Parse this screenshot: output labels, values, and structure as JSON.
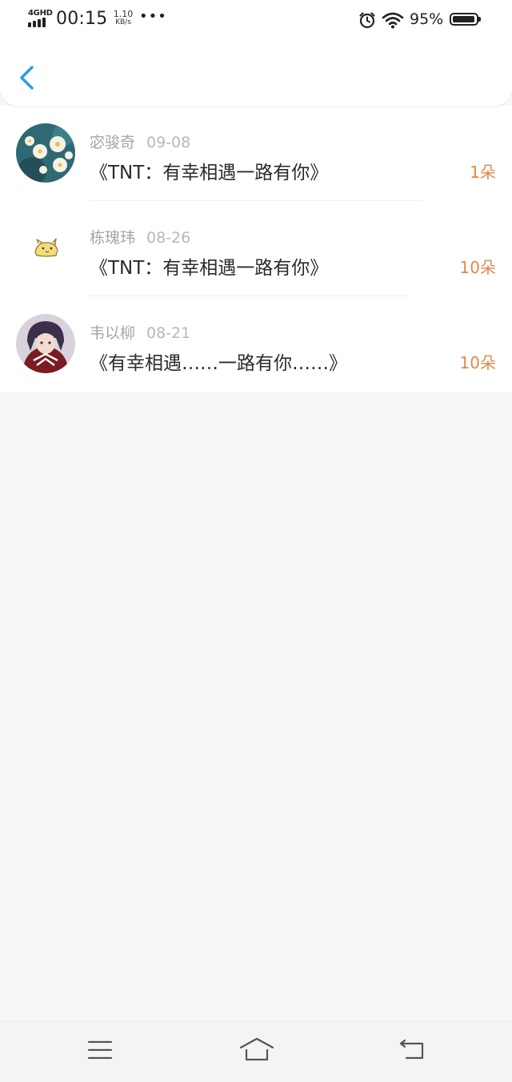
{
  "status_bar": {
    "network": "4GHD",
    "time": "00:15",
    "speed_value": "1.10",
    "speed_unit": "KB/s",
    "more": "•••",
    "battery_percent": "95%",
    "battery_level": 0.95
  },
  "nav": {
    "back_icon": "chevron-left-icon",
    "accent_color": "#2a9be6"
  },
  "records": [
    {
      "name": "宓骏奇",
      "date": "09-08",
      "title": "《TNT：有幸相遇一路有你》",
      "count": "1朵",
      "avatar": "flowers-avatar"
    },
    {
      "name": "栋瑰玮",
      "date": "08-26",
      "title": "《TNT：有幸相遇一路有你》",
      "count": "10朵",
      "avatar": "cartoon-avatar"
    },
    {
      "name": "韦以柳",
      "date": "08-21",
      "title": "《有幸相遇……一路有你……》",
      "count": "10朵",
      "avatar": "anime-avatar"
    }
  ],
  "bottom_nav": {
    "menu_icon": "menu-icon",
    "home_icon": "home-icon",
    "back_icon": "return-icon"
  },
  "colors": {
    "count": "#e0894b",
    "background": "#f8f6f7"
  }
}
